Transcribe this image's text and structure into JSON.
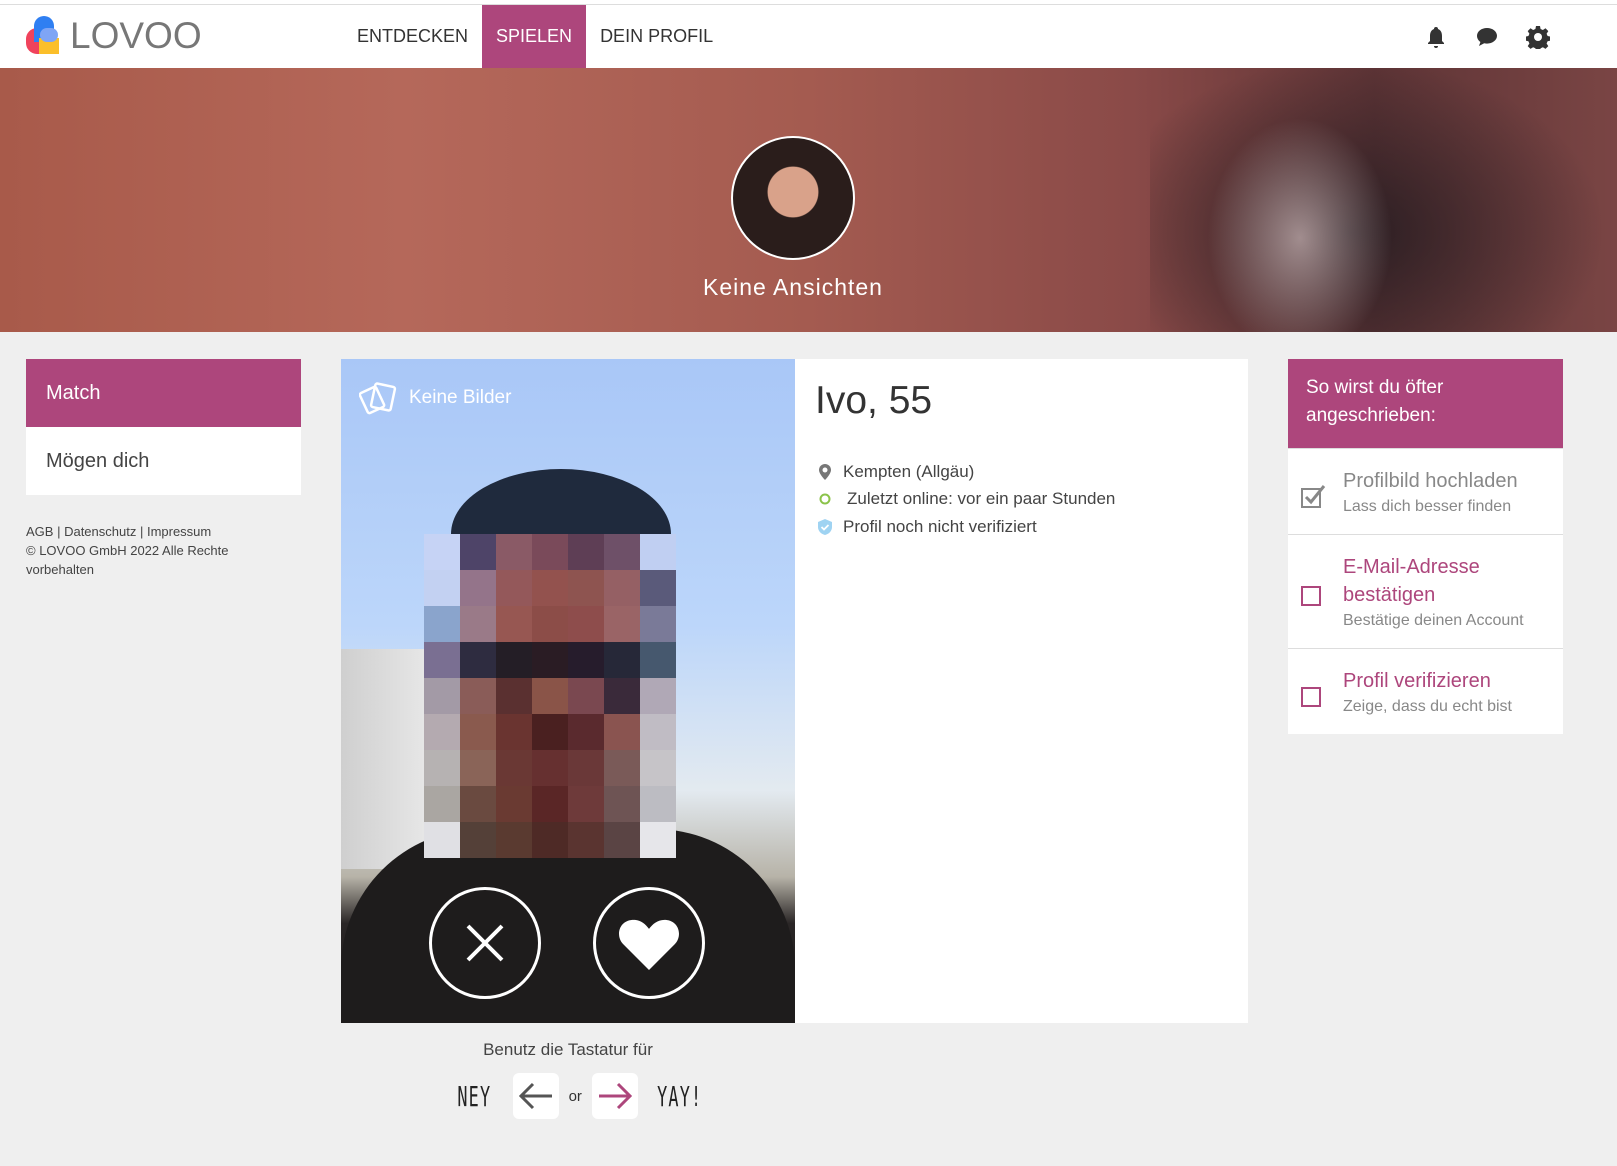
{
  "header": {
    "logo_text": "LOVOO",
    "nav": [
      {
        "label": "ENTDECKEN",
        "active": false
      },
      {
        "label": "SPIELEN",
        "active": true
      },
      {
        "label": "DEIN PROFIL",
        "active": false
      }
    ],
    "icons": [
      "bell-icon",
      "chat-icon",
      "gear-icon"
    ]
  },
  "banner": {
    "views_label": "Keine Ansichten"
  },
  "sidebar": {
    "items": [
      {
        "label": "Match",
        "active": true
      },
      {
        "label": "Mögen dich",
        "active": false
      }
    ]
  },
  "footer": {
    "links": [
      "AGB",
      "Datenschutz",
      "Impressum"
    ],
    "separator": " | ",
    "copyright": "© LOVOO GmbH 2022 Alle Rechte vorbehalten"
  },
  "card": {
    "no_pictures": "Keine Bilder",
    "dislike_icon": "close-icon",
    "like_icon": "heart-icon"
  },
  "profile": {
    "name_age": "Ivo, 55",
    "location": "Kempten (Allgäu)",
    "last_online": "Zuletzt online: vor ein paar Stunden",
    "verification": "Profil noch nicht verifiziert"
  },
  "keyboard": {
    "hint": "Benutz die Tastatur für",
    "ney": "NEY",
    "or": "or",
    "yay": "YAY!"
  },
  "tips": {
    "title": "So wirst du öfter angeschrieben:",
    "items": [
      {
        "title": "Profilbild hochladen",
        "subtitle": "Lass dich besser finden",
        "done": true
      },
      {
        "title": "E-Mail-Adresse bestätigen",
        "subtitle": "Bestätige deinen Account",
        "done": false
      },
      {
        "title": "Profil verifizieren",
        "subtitle": "Zeige, dass du echt bist",
        "done": false
      }
    ]
  },
  "colors": {
    "brand": "#ad467c",
    "online": "#8bc34a",
    "verify": "#9fd3f2"
  }
}
